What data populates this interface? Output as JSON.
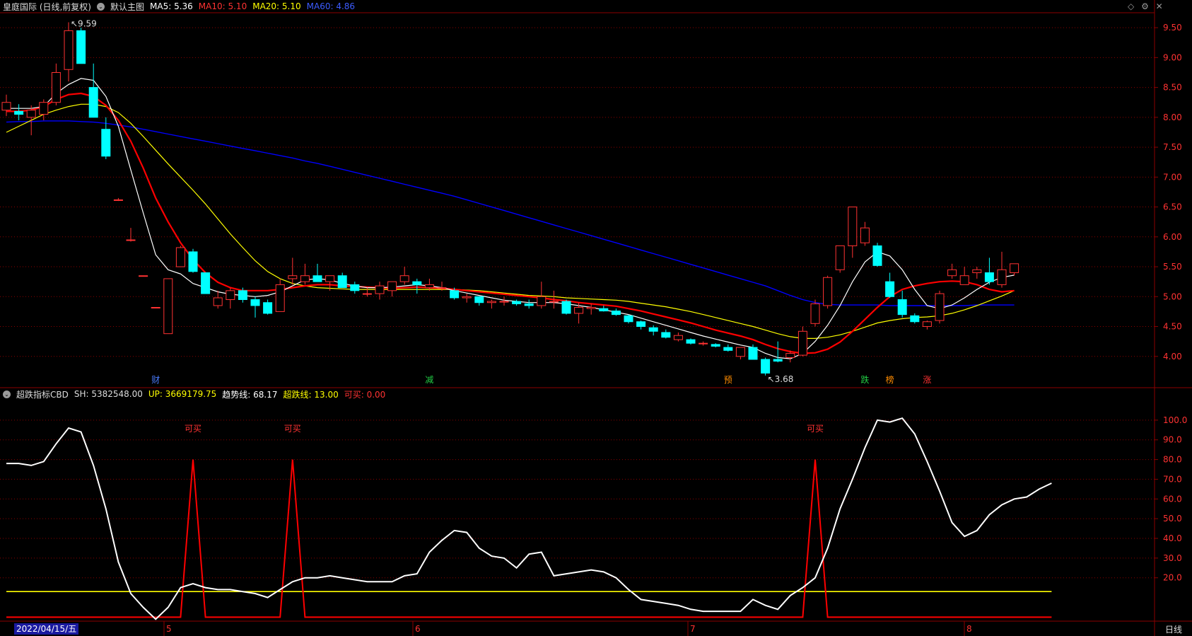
{
  "main_header": {
    "title": "皇庭国际 (日线,前复权)",
    "template": "默认主图",
    "ma5": "MA5: 5.36",
    "ma10": "MA10: 5.10",
    "ma20": "MA20: 5.10",
    "ma60": "MA60: 4.86"
  },
  "sub_header": {
    "title": "超跌指标CBD",
    "sh": "SH: 5382548.00",
    "up": "UP: 3669179.75",
    "trend": "趋势线: 68.17",
    "oversold": "超跌线: 13.00",
    "buyable": "可买: 0.00"
  },
  "toolbar": {
    "icons": [
      "diamond-icon",
      "settings-icon",
      "close-icon"
    ]
  },
  "footer": {
    "first_date": "2022/04/15/五",
    "months": [
      "5",
      "6",
      "7",
      "8"
    ],
    "period": "日线"
  },
  "colors": {
    "up": "#ff3232",
    "down": "#00ffff",
    "ma5": "#ffffff",
    "ma10": "#ff0000",
    "ma20": "#ffff00",
    "ma60": "#0000ff",
    "grid": "#8b0000",
    "oversold": "#ffff00"
  },
  "chart_data": [
    {
      "type": "candlestick",
      "ylim": [
        3.5,
        9.75
      ],
      "yticks": [
        "9.50",
        "9.00",
        "8.50",
        "8.00",
        "7.50",
        "7.00",
        "6.50",
        "6.00",
        "5.50",
        "5.00",
        "4.50",
        "4.00"
      ],
      "ytick_values": [
        9.5,
        9.0,
        8.5,
        8.0,
        7.5,
        7.0,
        6.5,
        6.0,
        5.5,
        5.0,
        4.5,
        4.0
      ],
      "ohlc": [
        [
          8.12,
          8.38,
          8.02,
          8.25
        ],
        [
          8.1,
          8.22,
          7.95,
          8.05
        ],
        [
          8.0,
          8.2,
          7.7,
          8.12
        ],
        [
          8.05,
          8.3,
          7.95,
          8.25
        ],
        [
          8.25,
          8.9,
          8.2,
          8.75
        ],
        [
          8.8,
          9.59,
          8.6,
          9.45
        ],
        [
          9.45,
          9.5,
          8.9,
          8.9
        ],
        [
          8.5,
          8.9,
          8.0,
          8.0
        ],
        [
          7.8,
          8.0,
          7.3,
          7.35
        ],
        [
          6.62,
          6.65,
          6.6,
          6.62
        ],
        [
          5.95,
          6.15,
          5.92,
          5.95
        ],
        [
          5.35,
          5.35,
          5.35,
          5.35
        ],
        [
          4.82,
          4.82,
          4.82,
          4.82
        ],
        [
          4.38,
          5.3,
          4.38,
          5.3
        ],
        [
          5.5,
          5.85,
          5.5,
          5.82
        ],
        [
          5.75,
          5.8,
          5.4,
          5.42
        ],
        [
          5.4,
          5.4,
          5.05,
          5.05
        ],
        [
          4.85,
          5.1,
          4.8,
          4.98
        ],
        [
          4.95,
          5.15,
          4.8,
          5.1
        ],
        [
          5.1,
          5.15,
          4.9,
          4.95
        ],
        [
          4.95,
          5.0,
          4.65,
          4.85
        ],
        [
          4.9,
          4.95,
          4.7,
          4.72
        ],
        [
          4.75,
          5.3,
          4.75,
          5.2
        ],
        [
          5.3,
          5.65,
          5.2,
          5.35
        ],
        [
          5.25,
          5.55,
          5.2,
          5.35
        ],
        [
          5.35,
          5.55,
          5.25,
          5.25
        ],
        [
          5.25,
          5.35,
          5.1,
          5.35
        ],
        [
          5.35,
          5.4,
          5.15,
          5.15
        ],
        [
          5.2,
          5.25,
          5.05,
          5.1
        ],
        [
          5.05,
          5.15,
          5.0,
          5.05
        ],
        [
          5.05,
          5.25,
          4.95,
          5.18
        ],
        [
          5.1,
          5.25,
          5.0,
          5.25
        ],
        [
          5.25,
          5.5,
          5.2,
          5.35
        ],
        [
          5.25,
          5.3,
          5.05,
          5.2
        ],
        [
          5.15,
          5.3,
          5.1,
          5.2
        ],
        [
          5.15,
          5.25,
          5.1,
          5.15
        ],
        [
          5.1,
          5.15,
          4.95,
          4.98
        ],
        [
          4.98,
          5.05,
          4.9,
          5.0
        ],
        [
          5.0,
          5.0,
          4.85,
          4.9
        ],
        [
          4.9,
          4.95,
          4.8,
          4.92
        ],
        [
          4.92,
          5.0,
          4.85,
          4.92
        ],
        [
          4.92,
          4.95,
          4.85,
          4.88
        ],
        [
          4.88,
          4.95,
          4.8,
          4.85
        ],
        [
          4.85,
          5.25,
          4.8,
          5.0
        ],
        [
          4.92,
          5.1,
          4.8,
          4.92
        ],
        [
          4.92,
          4.95,
          4.7,
          4.72
        ],
        [
          4.72,
          4.9,
          4.55,
          4.82
        ],
        [
          4.8,
          4.88,
          4.7,
          4.82
        ],
        [
          4.8,
          4.85,
          4.75,
          4.76
        ],
        [
          4.76,
          4.8,
          4.68,
          4.7
        ],
        [
          4.68,
          4.7,
          4.55,
          4.58
        ],
        [
          4.58,
          4.6,
          4.45,
          4.5
        ],
        [
          4.48,
          4.52,
          4.35,
          4.42
        ],
        [
          4.4,
          4.45,
          4.3,
          4.32
        ],
        [
          4.28,
          4.4,
          4.25,
          4.35
        ],
        [
          4.28,
          4.3,
          4.2,
          4.22
        ],
        [
          4.22,
          4.25,
          4.18,
          4.22
        ],
        [
          4.2,
          4.22,
          4.15,
          4.17
        ],
        [
          4.15,
          4.2,
          4.08,
          4.1
        ],
        [
          4.0,
          4.15,
          3.95,
          4.15
        ],
        [
          4.15,
          4.2,
          3.95,
          3.95
        ],
        [
          3.95,
          3.98,
          3.68,
          3.72
        ],
        [
          3.95,
          4.25,
          3.9,
          3.92
        ],
        [
          3.98,
          4.1,
          3.9,
          4.05
        ],
        [
          4.02,
          4.5,
          4.0,
          4.42
        ],
        [
          4.55,
          4.95,
          4.5,
          4.88
        ],
        [
          4.85,
          5.35,
          4.8,
          5.32
        ],
        [
          5.45,
          5.85,
          5.4,
          5.85
        ],
        [
          5.85,
          6.5,
          5.65,
          6.5
        ],
        [
          5.9,
          6.25,
          5.85,
          6.15
        ],
        [
          5.85,
          5.9,
          5.5,
          5.52
        ],
        [
          5.25,
          5.4,
          4.98,
          5.0
        ],
        [
          4.95,
          5.1,
          4.65,
          4.7
        ],
        [
          4.68,
          4.72,
          4.55,
          4.58
        ],
        [
          4.5,
          4.6,
          4.45,
          4.58
        ],
        [
          4.6,
          5.1,
          4.55,
          5.05
        ],
        [
          5.35,
          5.55,
          5.3,
          5.45
        ],
        [
          5.2,
          5.5,
          5.2,
          5.35
        ],
        [
          5.4,
          5.5,
          5.3,
          5.45
        ],
        [
          5.4,
          5.65,
          5.2,
          5.25
        ],
        [
          5.2,
          5.75,
          5.15,
          5.45
        ],
        [
          5.4,
          5.55,
          5.35,
          5.55
        ]
      ],
      "ma5": [
        8.15,
        8.15,
        8.15,
        8.18,
        8.4,
        8.55,
        8.65,
        8.62,
        8.35,
        7.85,
        7.12,
        6.4,
        5.7,
        5.45,
        5.38,
        5.22,
        5.15,
        5.08,
        5.04,
        5.02,
        5.0,
        5.02,
        5.08,
        5.18,
        5.28,
        5.3,
        5.28,
        5.22,
        5.18,
        5.15,
        5.15,
        5.16,
        5.18,
        5.2,
        5.18,
        5.15,
        5.1,
        5.06,
        5.02,
        4.98,
        4.94,
        4.92,
        4.9,
        4.9,
        4.9,
        4.88,
        4.85,
        4.82,
        4.78,
        4.74,
        4.7,
        4.64,
        4.58,
        4.52,
        4.46,
        4.4,
        4.34,
        4.29,
        4.24,
        4.19,
        4.15,
        4.05,
        3.98,
        3.96,
        4.05,
        4.25,
        4.52,
        4.85,
        5.25,
        5.58,
        5.75,
        5.68,
        5.45,
        5.12,
        4.85,
        4.8,
        4.86,
        4.98,
        5.12,
        5.24,
        5.32,
        5.36
      ],
      "ma10": [
        8.1,
        8.1,
        8.12,
        8.18,
        8.3,
        8.38,
        8.4,
        8.35,
        8.2,
        7.95,
        7.6,
        7.15,
        6.65,
        6.25,
        5.9,
        5.62,
        5.4,
        5.24,
        5.15,
        5.1,
        5.1,
        5.1,
        5.12,
        5.15,
        5.18,
        5.2,
        5.2,
        5.18,
        5.17,
        5.16,
        5.15,
        5.14,
        5.15,
        5.16,
        5.15,
        5.14,
        5.12,
        5.1,
        5.08,
        5.06,
        5.04,
        5.02,
        5.0,
        4.98,
        4.95,
        4.93,
        4.9,
        4.88,
        4.86,
        4.84,
        4.8,
        4.76,
        4.71,
        4.66,
        4.61,
        4.56,
        4.5,
        4.44,
        4.39,
        4.34,
        4.28,
        4.2,
        4.13,
        4.08,
        4.05,
        4.06,
        4.12,
        4.24,
        4.42,
        4.62,
        4.82,
        5.0,
        5.12,
        5.18,
        5.22,
        5.25,
        5.26,
        5.25,
        5.2,
        5.12,
        5.08,
        5.1
      ],
      "ma20": [
        7.75,
        7.85,
        7.95,
        8.05,
        8.12,
        8.18,
        8.22,
        8.22,
        8.18,
        8.08,
        7.9,
        7.68,
        7.45,
        7.22,
        7.0,
        6.78,
        6.55,
        6.3,
        6.05,
        5.82,
        5.6,
        5.42,
        5.3,
        5.22,
        5.18,
        5.15,
        5.14,
        5.13,
        5.12,
        5.12,
        5.12,
        5.12,
        5.12,
        5.12,
        5.12,
        5.12,
        5.12,
        5.11,
        5.1,
        5.08,
        5.06,
        5.04,
        5.02,
        5.01,
        5.0,
        4.98,
        4.97,
        4.96,
        4.95,
        4.94,
        4.92,
        4.89,
        4.86,
        4.83,
        4.79,
        4.75,
        4.7,
        4.65,
        4.6,
        4.55,
        4.5,
        4.44,
        4.38,
        4.33,
        4.3,
        4.3,
        4.32,
        4.36,
        4.42,
        4.49,
        4.56,
        4.6,
        4.63,
        4.65,
        4.66,
        4.68,
        4.72,
        4.78,
        4.85,
        4.93,
        5.01,
        5.1
      ],
      "ma60": [
        7.92,
        7.93,
        7.93,
        7.94,
        7.94,
        7.94,
        7.93,
        7.92,
        7.9,
        7.87,
        7.84,
        7.8,
        7.76,
        7.72,
        7.68,
        7.64,
        7.6,
        7.56,
        7.52,
        7.48,
        7.44,
        7.4,
        7.36,
        7.32,
        7.27,
        7.23,
        7.18,
        7.13,
        7.08,
        7.03,
        6.98,
        6.93,
        6.88,
        6.83,
        6.78,
        6.73,
        6.68,
        6.62,
        6.56,
        6.5,
        6.44,
        6.38,
        6.32,
        6.26,
        6.2,
        6.14,
        6.08,
        6.02,
        5.96,
        5.9,
        5.84,
        5.78,
        5.72,
        5.66,
        5.6,
        5.54,
        5.48,
        5.42,
        5.36,
        5.3,
        5.24,
        5.18,
        5.1,
        5.02,
        4.95,
        4.9,
        4.87,
        4.86,
        4.86,
        4.86,
        4.86,
        4.85,
        4.85,
        4.85,
        4.85,
        4.85,
        4.85,
        4.85,
        4.86,
        4.86,
        4.86,
        4.86
      ],
      "annotations": [
        {
          "text": "9.59",
          "index": 5,
          "value": 9.59
        },
        {
          "text": "3.68",
          "index": 61,
          "value": 3.68
        }
      ],
      "markers": [
        {
          "text": "财",
          "index": 12,
          "color": "#4a7cff"
        },
        {
          "text": "减",
          "index": 34,
          "color": "#22cc44"
        },
        {
          "text": "预",
          "index": 58,
          "color": "#ff8c00"
        },
        {
          "text": "跌",
          "index": 69,
          "color": "#22cc44"
        },
        {
          "text": "榜",
          "index": 71,
          "color": "#ff8c00"
        },
        {
          "text": "涨",
          "index": 74,
          "color": "#ff3232"
        }
      ]
    },
    {
      "type": "line",
      "ylim": [
        -2,
        110
      ],
      "yticks": [
        "100.0",
        "90.0",
        "80.0",
        "70.0",
        "60.0",
        "50.0",
        "40.0",
        "30.0",
        "20.0"
      ],
      "ytick_values": [
        100,
        90,
        80,
        70,
        60,
        50,
        40,
        30,
        20
      ],
      "series": [
        {
          "name": "趋势线",
          "color": "#ffffff",
          "values": [
            78,
            78,
            77,
            79,
            88,
            96,
            94,
            77,
            55,
            28,
            12,
            5,
            -1,
            5,
            15,
            17,
            15,
            14,
            14,
            13,
            12,
            10,
            14,
            18,
            20,
            20,
            21,
            20,
            19,
            18,
            18,
            18,
            21,
            22,
            33,
            39,
            44,
            43,
            35,
            31,
            30,
            25,
            32,
            33,
            21,
            22,
            23,
            24,
            23,
            20,
            14,
            9,
            8,
            7,
            6,
            4,
            3,
            3,
            3,
            3,
            9,
            6,
            4,
            11,
            15,
            20,
            35,
            55,
            70,
            86,
            100,
            99,
            101,
            93,
            79,
            64,
            48,
            41,
            44,
            52,
            57,
            60,
            61,
            65,
            68
          ]
        },
        {
          "name": "超跌线",
          "color": "#ffff00",
          "values": [
            13,
            13
          ]
        },
        {
          "name": "可买",
          "color": "#ff0000",
          "values": [
            0,
            0,
            0,
            0,
            0,
            0,
            0,
            0,
            0,
            0,
            0,
            0,
            0,
            0,
            0,
            80,
            0,
            0,
            0,
            0,
            0,
            0,
            0,
            80,
            0,
            0,
            0,
            0,
            0,
            0,
            0,
            0,
            0,
            0,
            0,
            0,
            0,
            0,
            0,
            0,
            0,
            0,
            0,
            0,
            0,
            0,
            0,
            0,
            0,
            0,
            0,
            0,
            0,
            0,
            0,
            0,
            0,
            0,
            0,
            0,
            0,
            0,
            0,
            0,
            0,
            80,
            0,
            0,
            0,
            0,
            0,
            0,
            0,
            0,
            0,
            0,
            0,
            0,
            0,
            0,
            0,
            0,
            0,
            0,
            0
          ]
        }
      ],
      "annotations": [
        {
          "text": "可买",
          "index": 15
        },
        {
          "text": "可买",
          "index": 23
        },
        {
          "text": "可买",
          "index": 65
        }
      ]
    }
  ]
}
